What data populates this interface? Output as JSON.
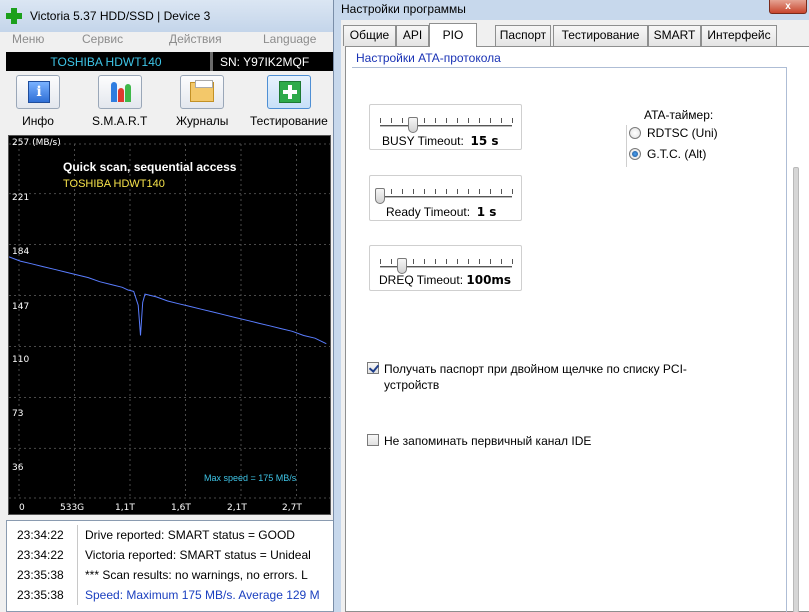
{
  "main_window": {
    "title": "Victoria 5.37 HDD/SSD | Device 3",
    "menu": [
      "Меню",
      "Сервис",
      "Действия",
      "Language"
    ],
    "drive_name": "TOSHIBA HDWT140",
    "serial": "SN: Y97IK2MQF",
    "toolbar": [
      {
        "label": "Инфо",
        "icon": "info-icon"
      },
      {
        "label": "S.M.A.R.T",
        "icon": "smart-icon"
      },
      {
        "label": "Журналы",
        "icon": "logs-icon"
      },
      {
        "label": "Тестирование",
        "icon": "testing-icon"
      }
    ],
    "graph": {
      "unit_label": "(MB/s)",
      "title": "Quick scan, sequential access",
      "subtitle": "TOSHIBA HDWT140",
      "max_speed_label": "Max speed = 175 MB/s",
      "y_ticks": [
        "257",
        "221",
        "184",
        "147",
        "110",
        "73",
        "36",
        "0"
      ],
      "x_ticks": [
        "0",
        "533G",
        "1,1T",
        "1,6T",
        "2,1T",
        "2,7T"
      ]
    },
    "log": [
      {
        "time": "23:34:22",
        "message": "Drive reported: SMART status = GOOD",
        "color": "#000000"
      },
      {
        "time": "23:34:22",
        "message": "Victoria reported: SMART status = Unideal",
        "color": "#000000"
      },
      {
        "time": "23:35:38",
        "message": "*** Scan results: no warnings, no errors. L",
        "color": "#000000"
      },
      {
        "time": "23:35:38",
        "message": "Speed: Maximum 175 MB/s. Average 129 M",
        "color": "#1a3fbf"
      }
    ]
  },
  "chart_data": {
    "type": "line",
    "title": "Quick scan, sequential access",
    "subtitle": "TOSHIBA HDWT140",
    "ylabel": "(MB/s)",
    "ylim": [
      0,
      257
    ],
    "xlim": [
      0,
      2.85
    ],
    "x_ticks": [
      "0",
      "533G",
      "1,1T",
      "1,6T",
      "2,1T",
      "2,7T"
    ],
    "y_ticks": [
      0,
      36,
      73,
      110,
      147,
      184,
      221,
      257
    ],
    "grid": true,
    "series": [
      {
        "color": "#5a7dff",
        "x": [
          0,
          0.1,
          0.2,
          0.3,
          0.4,
          0.5,
          0.6,
          0.7,
          0.8,
          0.9,
          1.0,
          1.05,
          1.1,
          1.14,
          1.16,
          1.18,
          1.2,
          1.3,
          1.4,
          1.5,
          1.6,
          1.7,
          1.8,
          1.9,
          2.0,
          2.1,
          2.2,
          2.3,
          2.4,
          2.5,
          2.6,
          2.7,
          2.8
        ],
        "values": [
          175,
          172,
          170,
          168,
          166,
          164,
          162,
          160,
          157,
          155,
          153,
          151,
          150,
          140,
          118,
          142,
          148,
          146,
          143,
          141,
          139,
          137,
          135,
          133,
          131,
          129,
          127,
          125,
          123,
          121,
          118,
          116,
          112
        ]
      }
    ],
    "annotations": [
      "Max speed = 175 MB/s"
    ]
  },
  "settings_dialog": {
    "title": "Настройки программы",
    "close_glyph": "x",
    "tabs": [
      "Общие",
      "API",
      "PIO",
      "Паспорт",
      "Тестирование",
      "SMART",
      "Интерфейс"
    ],
    "active_tab": "PIO",
    "section_title": "Настройки ATA-протокола",
    "sliders": [
      {
        "label": "BUSY Timeout:",
        "value": "15 s",
        "level_ticks": 3,
        "max_ticks": 12
      },
      {
        "label": "Ready Timeout:",
        "value": "1 s",
        "level_ticks": 0,
        "max_ticks": 12
      },
      {
        "label": "DREQ Timeout:",
        "value": "100ms",
        "level_ticks": 2,
        "max_ticks": 12
      }
    ],
    "ata_timer": {
      "label": "ATA-таймер:",
      "options": [
        {
          "label": "RDTSC (Uni)",
          "selected": false
        },
        {
          "label": "G.T.C.  (Alt)",
          "selected": true
        }
      ]
    },
    "checkboxes": [
      {
        "label": "Получать паспорт при двойном щелчке по списку PCI-устройств",
        "checked": true
      },
      {
        "label": "Не запоминать первичный канал IDE",
        "checked": false
      }
    ]
  }
}
